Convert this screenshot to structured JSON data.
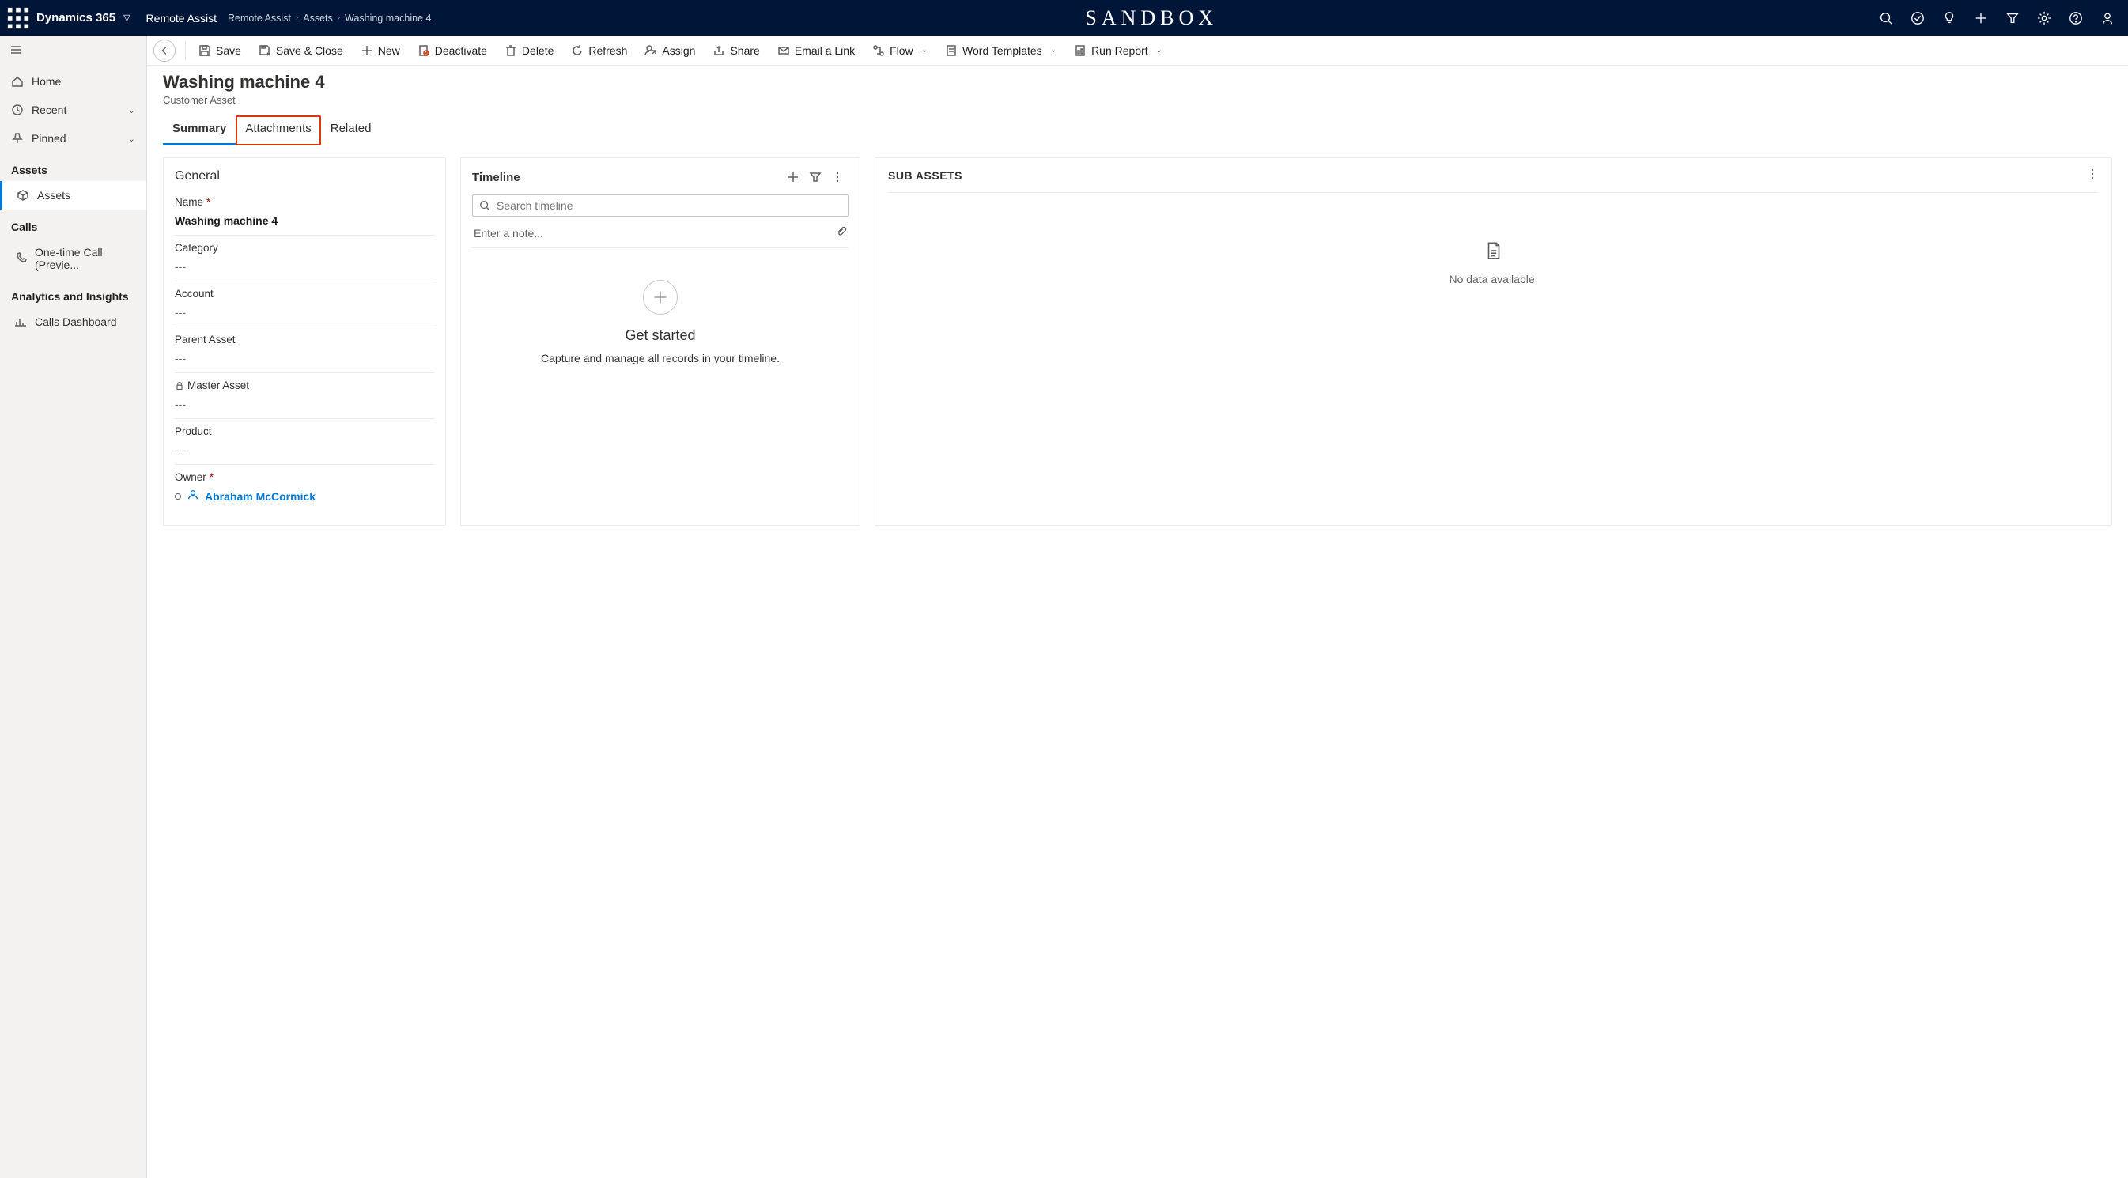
{
  "topnav": {
    "brand": "Dynamics 365",
    "app": "Remote Assist",
    "centerText": "SANDBOX",
    "breadcrumb": [
      "Remote Assist",
      "Assets",
      "Washing machine 4"
    ]
  },
  "sidebar": {
    "home": "Home",
    "recent": "Recent",
    "pinned": "Pinned",
    "sections": [
      {
        "title": "Assets",
        "items": [
          {
            "label": "Assets",
            "active": true
          }
        ]
      },
      {
        "title": "Calls",
        "items": [
          {
            "label": "One-time Call (Previe...",
            "active": false
          }
        ]
      },
      {
        "title": "Analytics and Insights",
        "items": [
          {
            "label": "Calls Dashboard",
            "active": false
          }
        ]
      }
    ]
  },
  "commands": {
    "save": "Save",
    "saveClose": "Save & Close",
    "new": "New",
    "deactivate": "Deactivate",
    "delete": "Delete",
    "refresh": "Refresh",
    "assign": "Assign",
    "share": "Share",
    "emailLink": "Email a Link",
    "flow": "Flow",
    "wordTemplates": "Word Templates",
    "runReport": "Run Report"
  },
  "record": {
    "title": "Washing machine  4",
    "subtype": "Customer Asset",
    "tabs": {
      "summary": "Summary",
      "attachments": "Attachments",
      "related": "Related"
    }
  },
  "general": {
    "heading": "General",
    "name": {
      "label": "Name",
      "value": "Washing machine  4"
    },
    "category": {
      "label": "Category",
      "value": "---"
    },
    "account": {
      "label": "Account",
      "value": "---"
    },
    "parentAsset": {
      "label": "Parent Asset",
      "value": "---"
    },
    "masterAsset": {
      "label": "Master Asset",
      "value": "---"
    },
    "product": {
      "label": "Product",
      "value": "---"
    },
    "owner": {
      "label": "Owner",
      "value": "Abraham McCormick"
    }
  },
  "timeline": {
    "heading": "Timeline",
    "searchPlaceholder": "Search timeline",
    "notePlaceholder": "Enter a note...",
    "emptyTitle": "Get started",
    "emptyBody": "Capture and manage all records in your timeline."
  },
  "subassets": {
    "heading": "SUB ASSETS",
    "empty": "No data available."
  }
}
